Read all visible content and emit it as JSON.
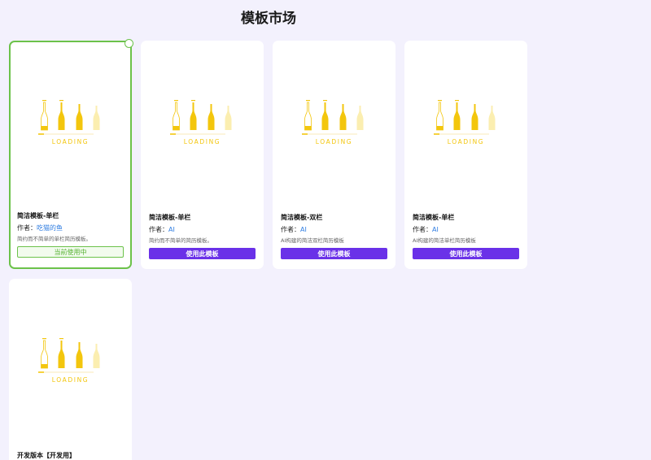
{
  "page": {
    "title": "模板市场"
  },
  "loader": {
    "text": "LOADING",
    "color": "#f3c60d"
  },
  "colors": {
    "accent": "#6a31e8",
    "active_border": "#6cc24a",
    "link": "#2f7de1"
  },
  "templates": [
    {
      "name": "简洁模板-单栏",
      "author_label": "作者：",
      "author": "吃猫的鱼",
      "desc": "简约而不简单的单栏简历模板。",
      "button": "当前使用中",
      "state": "current"
    },
    {
      "name": "简洁模板-单栏",
      "author_label": "作者：",
      "author": "AI",
      "desc": "简约而不简单的简历模板。",
      "button": "使用此模板",
      "state": "available"
    },
    {
      "name": "简洁模板-双栏",
      "author_label": "作者：",
      "author": "AI",
      "desc": "AI构建的简洁双栏简历模板",
      "button": "使用此模板",
      "state": "available"
    },
    {
      "name": "简洁模板-单栏",
      "author_label": "作者：",
      "author": "AI",
      "desc": "AI构建的简洁单栏简历模板",
      "button": "使用此模板",
      "state": "available"
    },
    {
      "name": "开发版本【开发用】",
      "state": "partial"
    }
  ]
}
